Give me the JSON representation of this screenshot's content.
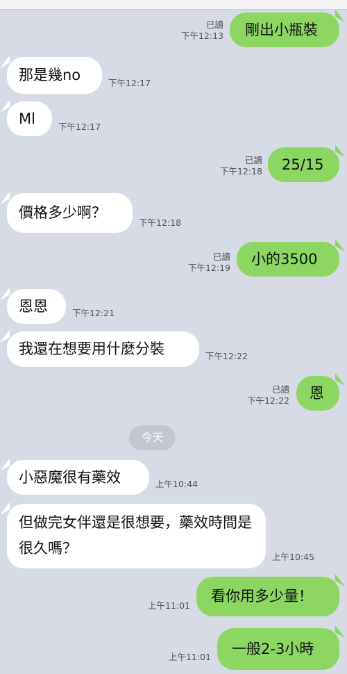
{
  "messages": [
    {
      "text": "剛出小瓶裝",
      "status": "已讀",
      "time": "下午12:13"
    },
    {
      "text": "那是幾no",
      "time": "下午12:17"
    },
    {
      "text": "Ml",
      "time": "下午12:17"
    },
    {
      "text": "25/15",
      "status": "已讀",
      "time": "下午12:18"
    },
    {
      "text": "價格多少啊？",
      "time": "下午12:18"
    },
    {
      "text": "小的3500",
      "status": "已讀",
      "time": "下午12:19"
    },
    {
      "text": "恩恩",
      "time": "下午12:21"
    },
    {
      "text": "我還在想要用什麼分裝",
      "time": "下午12:22"
    },
    {
      "text": "恩",
      "status": "已讀",
      "time": "下午12:22"
    },
    {
      "text": "小惡魔很有藥效",
      "time": "上午10:44"
    },
    {
      "text": "但做完女伴還是很想要，藥效時間是很久嗎？",
      "time": "上午10:45"
    },
    {
      "text": "看你用多少量！",
      "time": "上午11:01"
    },
    {
      "text": "一般2-3小時",
      "time": "上午11:01"
    }
  ],
  "date_divider": "今天",
  "colors": {
    "background": "#d7dbe5",
    "incoming_bubble": "#ffffff",
    "outgoing_bubble": "#8bd762"
  }
}
